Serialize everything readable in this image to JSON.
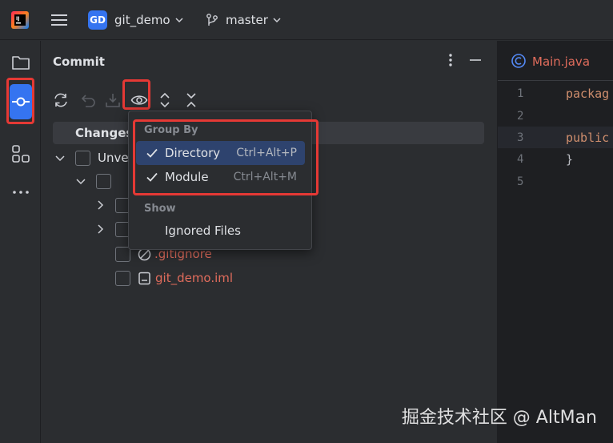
{
  "titlebar": {
    "project_badge": "GD",
    "project_name": "git_demo",
    "branch_name": "master"
  },
  "commit_panel": {
    "title": "Commit",
    "changes_label": "Changes",
    "tree": {
      "unversioned_label": "Unve",
      "files": [
        {
          "name": ".gitignore",
          "status": "unversioned"
        },
        {
          "name": "git_demo.iml",
          "status": "unversioned"
        }
      ]
    }
  },
  "popup": {
    "group_by_header": "Group By",
    "items": [
      {
        "label": "Directory",
        "shortcut": "Ctrl+Alt+P",
        "checked": true,
        "selected": true
      },
      {
        "label": "Module",
        "shortcut": "Ctrl+Alt+M",
        "checked": true,
        "selected": false
      }
    ],
    "show_header": "Show",
    "show_items": [
      {
        "label": "Ignored Files"
      }
    ]
  },
  "editor": {
    "tab_label": "Main.java",
    "line_numbers": [
      "1",
      "2",
      "3",
      "4",
      "5"
    ],
    "code": {
      "line1": "packag",
      "line3": "public",
      "line4": "}"
    }
  },
  "watermark": "掘金技术社区 @ AltMan",
  "colors": {
    "accent": "#3574f0",
    "highlight_box": "#e53935",
    "unversioned_file": "#e06c5c",
    "selected_menu_bg": "#2e436e"
  }
}
